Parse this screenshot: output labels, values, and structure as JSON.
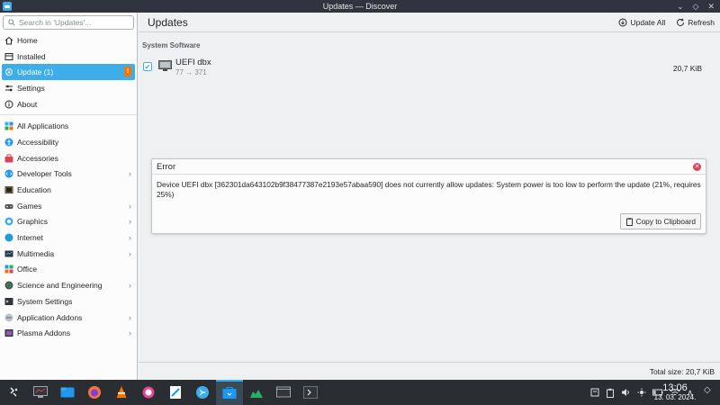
{
  "window": {
    "title": "Updates — Discover",
    "buttons": [
      "⌄",
      "◇",
      "✕"
    ]
  },
  "sidebar": {
    "search_placeholder": "Search in 'Updates'...",
    "top_items": [
      {
        "label": "Home",
        "icon": "home-icon"
      },
      {
        "label": "Installed",
        "icon": "installed-icon"
      },
      {
        "label": "Update (1)",
        "icon": "update-icon",
        "active": true,
        "badge": "!"
      },
      {
        "label": "Settings",
        "icon": "settings-icon"
      },
      {
        "label": "About",
        "icon": "about-icon"
      }
    ],
    "categories": [
      {
        "label": "All Applications",
        "chevron": false
      },
      {
        "label": "Accessibility",
        "chevron": false
      },
      {
        "label": "Accessories",
        "chevron": false
      },
      {
        "label": "Developer Tools",
        "chevron": true
      },
      {
        "label": "Education",
        "chevron": false
      },
      {
        "label": "Games",
        "chevron": true
      },
      {
        "label": "Graphics",
        "chevron": true
      },
      {
        "label": "Internet",
        "chevron": true
      },
      {
        "label": "Multimedia",
        "chevron": true
      },
      {
        "label": "Office",
        "chevron": false
      },
      {
        "label": "Science and Engineering",
        "chevron": true
      },
      {
        "label": "System Settings",
        "chevron": false
      },
      {
        "label": "Application Addons",
        "chevron": true
      },
      {
        "label": "Plasma Addons",
        "chevron": true
      }
    ]
  },
  "header": {
    "title": "Updates",
    "update_all": "Update All",
    "refresh": "Refresh"
  },
  "content": {
    "section": "System Software",
    "update": {
      "name": "UEFI dbx",
      "version": "77 → 371",
      "size": "20,7 KiB",
      "checked": true
    }
  },
  "dialog": {
    "title": "Error",
    "message": "Device UEFI dbx [362301da643102b9f38477387e2193e57abaa590] does not currently allow updates: System power is too low to perform the update (21%, requires 25%)",
    "copy_button": "Copy to Clipboard"
  },
  "footer": {
    "total": "Total size: 20,7 KiB"
  },
  "taskbar": {
    "clock_time": "13:06",
    "clock_date": "13. 03. 2024.",
    "accent": "#3daee9"
  }
}
